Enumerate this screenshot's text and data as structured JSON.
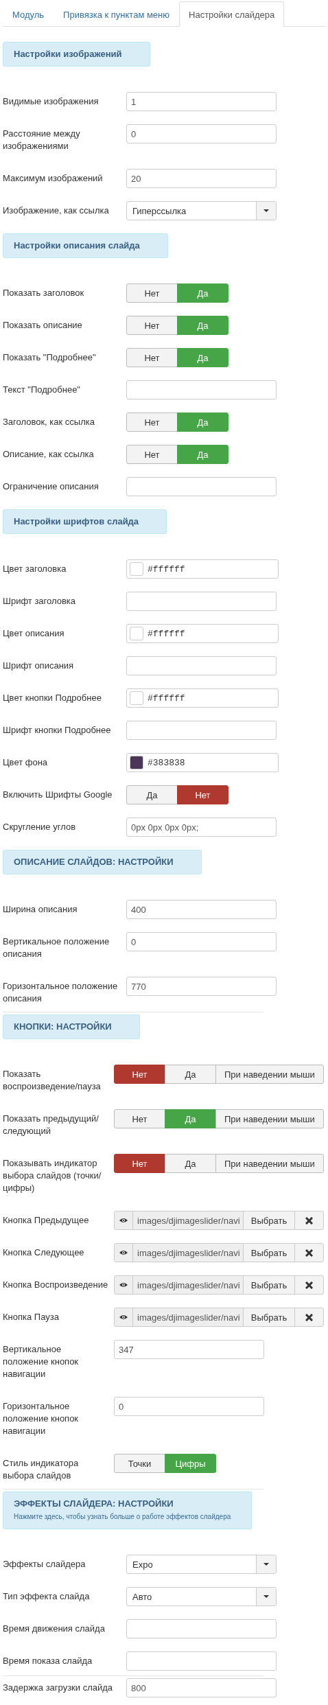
{
  "tabs": [
    {
      "label": "Модуль",
      "selected": false
    },
    {
      "label": "Привязка к пунктам меню",
      "selected": false
    },
    {
      "label": "Настройки слайдера",
      "selected": true
    }
  ],
  "sections": [
    {
      "title": "Настройки изображений",
      "fields": [
        {
          "kind": "text",
          "label": "Видимые изображения",
          "value": "1"
        },
        {
          "kind": "text",
          "label": "Расстояние между изображениями",
          "value": "0"
        },
        {
          "kind": "text",
          "label": "Максимум изображений",
          "value": "20"
        },
        {
          "kind": "select",
          "label": "Изображение, как ссылка",
          "value": "Гиперссылка"
        }
      ]
    },
    {
      "title": "Настройки описания слайда",
      "fields": [
        {
          "kind": "toggle",
          "label": "Показать заголовок",
          "options": [
            {
              "label": "Нет",
              "selected": false
            },
            {
              "label": "Да",
              "selected": true,
              "color": "#46a546"
            }
          ]
        },
        {
          "kind": "toggle",
          "label": "Показать описание",
          "options": [
            {
              "label": "Нет",
              "selected": false
            },
            {
              "label": "Да",
              "selected": true,
              "color": "#46a546"
            }
          ]
        },
        {
          "kind": "toggle",
          "label": "Показать \"Подробнее\"",
          "options": [
            {
              "label": "Нет",
              "selected": false
            },
            {
              "label": "Да",
              "selected": true,
              "color": "#46a546"
            }
          ]
        },
        {
          "kind": "text",
          "label": "Текст \"Подробнее\""
        },
        {
          "kind": "toggle",
          "label": "Заголовок, как ссылка",
          "options": [
            {
              "label": "Нет",
              "selected": false
            },
            {
              "label": "Да",
              "selected": true,
              "color": "#46a546"
            }
          ]
        },
        {
          "kind": "toggle",
          "label": "Описание, как ссылка",
          "options": [
            {
              "label": "Нет",
              "selected": false
            },
            {
              "label": "Да",
              "selected": true,
              "color": "#46a546"
            }
          ]
        },
        {
          "kind": "text",
          "label": "Ограничение описания"
        }
      ]
    },
    {
      "title": "Настройки шрифтов слайда",
      "fields": [
        {
          "kind": "color",
          "label": "Цвет заголовка",
          "value": "#ffffff",
          "color": "#ffffff"
        },
        {
          "kind": "text",
          "label": "Шрифт заголовка"
        },
        {
          "kind": "color",
          "label": "Цвет описания",
          "value": "#ffffff",
          "color": "#ffffff"
        },
        {
          "kind": "text",
          "label": "Шрифт описания"
        },
        {
          "kind": "color",
          "label": "Цвет кнопки Подробнее",
          "value": "#ffffff",
          "color": "#ffffff"
        },
        {
          "kind": "text",
          "label": "Шрифт кнопки Подробнее"
        },
        {
          "kind": "color",
          "label": "Цвет фона",
          "value": "#383838",
          "color": "#4b3558"
        },
        {
          "kind": "toggle",
          "label": "Включить Шрифты Google",
          "options": [
            {
              "label": "Да",
              "selected": false
            },
            {
              "label": "Нет",
              "selected": true,
              "color": "#b0392f"
            }
          ]
        },
        {
          "kind": "text",
          "label": "Скругление углов",
          "value": "0px 0px 0px 0px;"
        }
      ]
    },
    {
      "title": "ОПИСАНИЕ СЛАЙДОВ: НАСТРОЙКИ",
      "fields": [
        {
          "kind": "text",
          "label": "Ширина описания",
          "value": "400"
        },
        {
          "kind": "text",
          "label": "Вертикальное положение описания",
          "value": "0"
        },
        {
          "kind": "text",
          "label": "Горизонтальное положение описания",
          "value": "770"
        }
      ]
    },
    {
      "title": "КНОПКИ: НАСТРОЙКИ",
      "rule_above": true,
      "fields": [
        {
          "kind": "toggle",
          "label": "Показать воспроизведение/пауза",
          "options": [
            {
              "label": "Нет",
              "selected": true,
              "color": "#b0392f"
            },
            {
              "label": "Да",
              "selected": false
            },
            {
              "label": "При наведении мыши",
              "selected": false
            }
          ]
        },
        {
          "kind": "toggle",
          "label": "Показать предыдущий/следующий",
          "options": [
            {
              "label": "Нет",
              "selected": false
            },
            {
              "label": "Да",
              "selected": true,
              "color": "#46a546"
            },
            {
              "label": "При наведении мыши",
              "selected": false
            }
          ]
        },
        {
          "kind": "toggle",
          "label": "Показывать индикатор выбора слайдов (точки/цифры)",
          "options": [
            {
              "label": "Нет",
              "selected": true,
              "color": "#b0392f"
            },
            {
              "label": "Да",
              "selected": false
            },
            {
              "label": "При наведении мыши",
              "selected": false
            }
          ]
        },
        {
          "kind": "media",
          "label": "Кнопка Предыдущее",
          "value": "images/djimageslider/navi",
          "button": "Выбрать"
        },
        {
          "kind": "media",
          "label": "Кнопка Следующее",
          "value": "images/djimageslider/navi",
          "button": "Выбрать"
        },
        {
          "kind": "media",
          "label": "Кнопка Воспроизведение",
          "value": "images/djimageslider/navi",
          "button": "Выбрать"
        },
        {
          "kind": "media",
          "label": "Кнопка Пауза",
          "value": "images/djimageslider/navi",
          "button": "Выбрать"
        },
        {
          "kind": "text",
          "label": "Вертикальное положение кнопок навигации",
          "value": "347"
        },
        {
          "kind": "text",
          "label": "Горизонтальное положение кнопок навигации",
          "value": "0"
        },
        {
          "kind": "toggle",
          "label": "Стиль индикатора выбора слайдов",
          "options": [
            {
              "label": "Точки",
              "selected": false
            },
            {
              "label": "Цифры",
              "selected": true,
              "color": "#46a546"
            }
          ]
        }
      ]
    },
    {
      "title": "ЭФФЕКТЫ СЛАЙДЕРА: НАСТРОЙКИ",
      "subtitle": "Нажмите здесь, чтобы узнать больше о работе эффектов слайдера",
      "rule_above": true,
      "fields": [
        {
          "kind": "select",
          "label": "Эффекты слайдера",
          "value": "Expo"
        },
        {
          "kind": "select",
          "label": "Тип эффекта слайда",
          "value": "Авто"
        },
        {
          "kind": "text",
          "label": "Время движения слайда"
        },
        {
          "kind": "text",
          "label": "Время показа слайда"
        },
        {
          "kind": "text",
          "label": "Задержка загрузки слайда",
          "value": "800",
          "rule_above": true
        }
      ]
    }
  ]
}
